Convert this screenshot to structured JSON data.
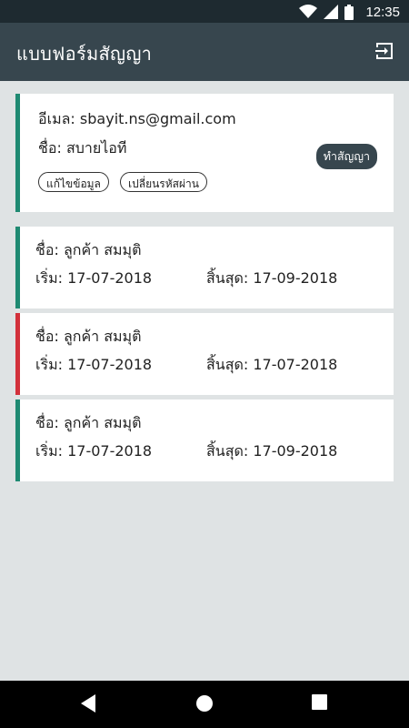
{
  "status_bar": {
    "time": "12:35",
    "icons": [
      "wifi-icon",
      "signal-icon",
      "battery-icon"
    ]
  },
  "app_bar": {
    "title": "แบบฟอร์มสัญญา",
    "action_icon": "logout-icon"
  },
  "profile": {
    "email_label": "อีเมล:",
    "email": "sbayit.ns@gmail.com",
    "name_label": "ชื่อ:",
    "name": "สบายไอที",
    "make_contract_button": "ทำสัญญา",
    "edit_button": "แก้ไขข้อมูล",
    "change_password_button": "เปลี่ยนรหัสผ่าน"
  },
  "contracts": [
    {
      "name": "ชื่อ: ลูกค้า สมมุติ",
      "start": "เริ่ม: 17-07-2018",
      "end": "สิ้นสุด: 17-09-2018",
      "status_color": "#1f8a72"
    },
    {
      "name": "ชื่อ: ลูกค้า สมมุติ",
      "start": "เริ่ม: 17-07-2018",
      "end": "สิ้นสุด: 17-07-2018",
      "status_color": "#d2313b"
    },
    {
      "name": "ชื่อ: ลูกค้า สมมุติ",
      "start": "เริ่ม: 17-07-2018",
      "end": "สิ้นสุด: 17-09-2018",
      "status_color": "#1f8a72"
    }
  ],
  "colors": {
    "app_bar": "#37464e",
    "status_bar": "#1e2a30",
    "accent_green": "#1f8a72",
    "accent_red": "#d2313b",
    "background": "#dfe3e4"
  },
  "nav_bar": {
    "icons": [
      "back-icon",
      "home-icon",
      "recents-icon"
    ]
  }
}
